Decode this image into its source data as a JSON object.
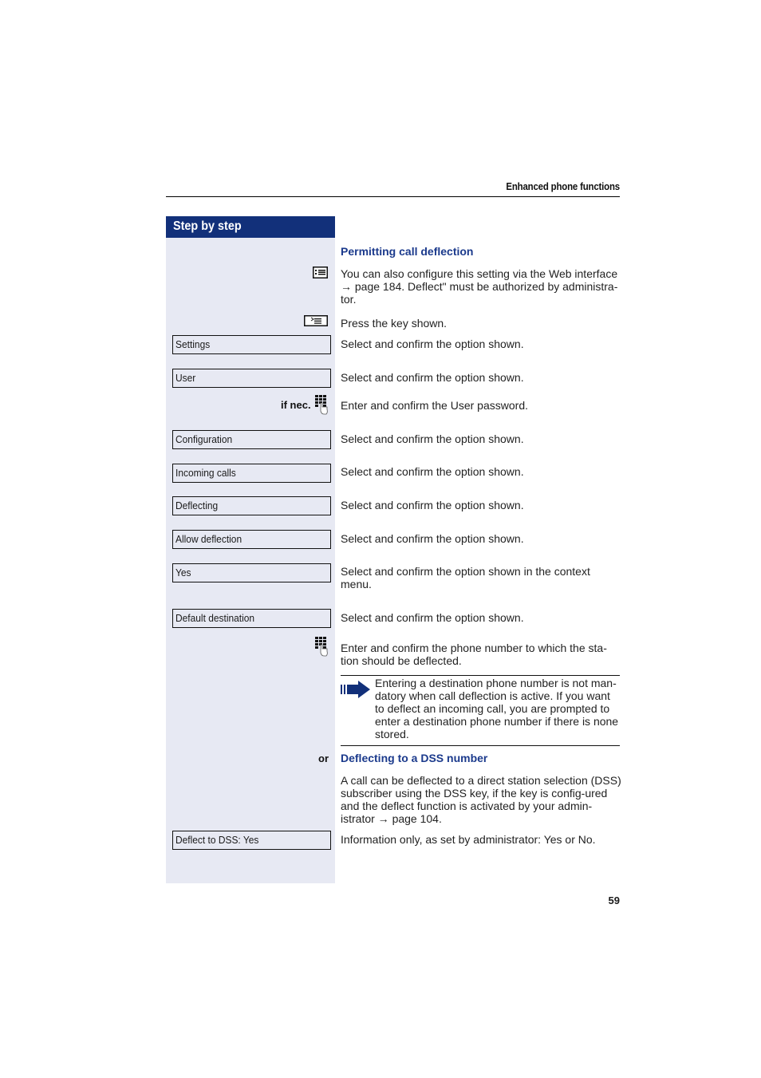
{
  "header": {
    "title": "Enhanced phone functions"
  },
  "sidebar": {
    "title": "Step by step"
  },
  "sections": {
    "permitting": {
      "title": "Permitting call deflection"
    },
    "dss": {
      "title": "Deflecting to a DSS number",
      "or_label": "or"
    }
  },
  "icons": {
    "web_interface": "web-interface-icon",
    "menu_key": "menu-key-icon",
    "keypad": "keypad-icon",
    "note_arrow": "note-arrow-icon"
  },
  "steps": [
    {
      "kind": "text",
      "text": "You can also configure this setting via the Web interface → page 184. Deflect\" must be authorized by administra-tor."
    },
    {
      "kind": "key",
      "text": "Press the key shown."
    },
    {
      "kind": "menu",
      "option": "Settings",
      "text": "Select and confirm the option shown."
    },
    {
      "kind": "menu",
      "option": "User",
      "text": "Select and confirm the option shown."
    },
    {
      "kind": "keypad",
      "label": "if nec.",
      "text": "Enter and confirm the User password."
    },
    {
      "kind": "menu",
      "option": "Configuration",
      "text": "Select and confirm the option shown."
    },
    {
      "kind": "menu",
      "option": "Incoming calls",
      "text": "Select and confirm the option shown."
    },
    {
      "kind": "menu",
      "option": "Deflecting",
      "text": "Select and confirm the option shown."
    },
    {
      "kind": "menu",
      "option": "Allow deflection",
      "text": "Select and confirm the option shown."
    },
    {
      "kind": "menu",
      "option": "Yes",
      "text": "Select and confirm the option shown in the context menu."
    },
    {
      "kind": "menu",
      "option": "Default destination",
      "text": "Select and confirm the option shown."
    },
    {
      "kind": "keypad",
      "text": "Enter and confirm the phone number to which the sta-tion should be deflected."
    },
    {
      "kind": "note",
      "text": "Entering a destination phone number is not man-datory when call deflection is active. If you want to deflect an incoming call, you are prompted to enter a destination phone number if there is none stored."
    },
    {
      "kind": "text",
      "text": "A call can be deflected to a direct station selection (DSS) subscriber using the DSS key, if the key is config-ured and the deflect function is activated by your admin-istrator → page 104."
    },
    {
      "kind": "menu",
      "option": "Deflect to DSS: Yes",
      "text": "Information only, as set by administrator: Yes or No."
    }
  ],
  "footer": {
    "page_number": "59"
  }
}
